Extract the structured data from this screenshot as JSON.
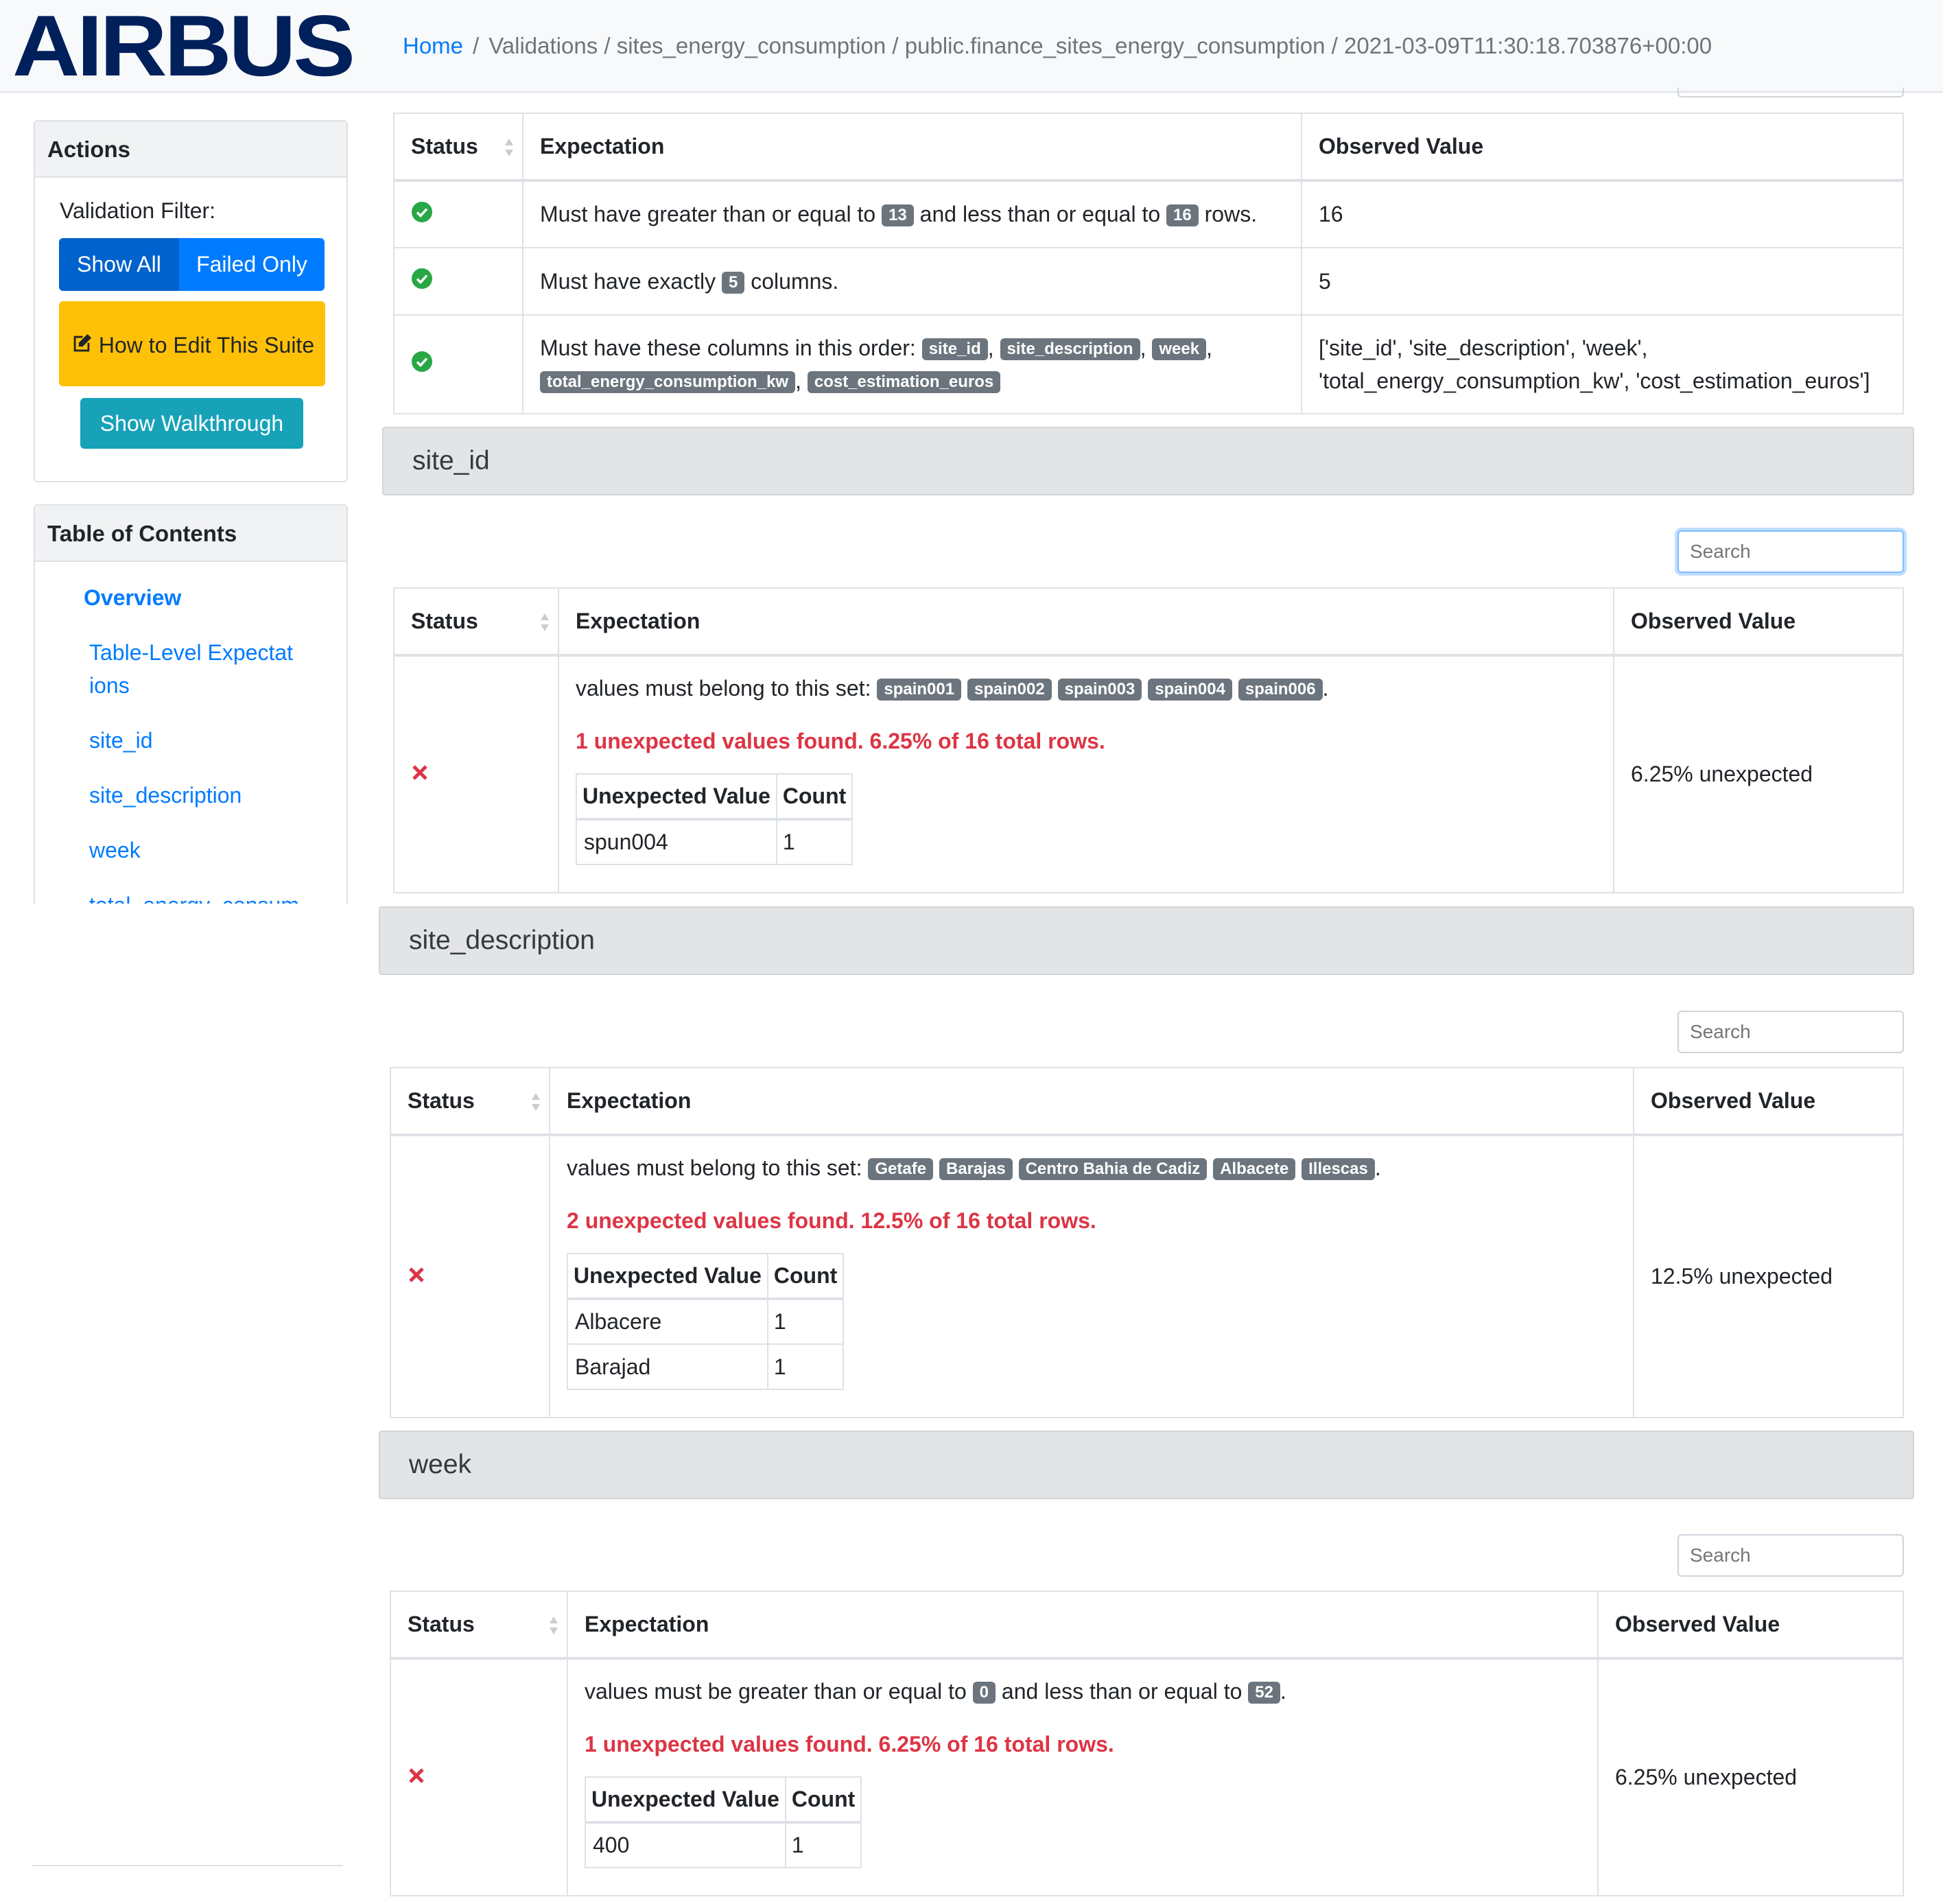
{
  "header": {
    "brand": "AIRBUS",
    "breadcrumb": {
      "home": "Home",
      "separator": "/",
      "path": "Validations / sites_energy_consumption / public.finance_sites_energy_consumption / 2021-03-09T11:30:18.703876+00:00"
    }
  },
  "actions": {
    "title": "Actions",
    "filter_label": "Validation Filter:",
    "show_all": "Show All",
    "failed_only": "Failed Only",
    "edit_suite": "How to Edit This Suite",
    "walkthrough": "Show Walkthrough"
  },
  "toc": {
    "title": "Table of Contents",
    "items": [
      "Overview",
      "Table-Level Expectat ions",
      "site_id",
      "site_description",
      "week",
      "total_energy_consum"
    ]
  },
  "columns": {
    "status": "Status",
    "expectation": "Expectation",
    "observed": "Observed Value"
  },
  "search_placeholder": "Search",
  "unexpected_headers": {
    "value": "Unexpected Value",
    "count": "Count"
  },
  "table_level": {
    "rows": [
      {
        "status": "success",
        "text_a": "Must have greater than or equal to",
        "badge_a": "13",
        "text_b": "and less than or equal to",
        "badge_b": "16",
        "text_c": "rows.",
        "observed": "16"
      },
      {
        "status": "success",
        "text_a": "Must have exactly",
        "badge_a": "5",
        "text_b": "columns.",
        "observed": "5"
      },
      {
        "status": "success",
        "text_a": "Must have these columns in this order:",
        "badges": [
          "site_id",
          "site_description",
          "week",
          "total_energy_consumption_kw",
          "cost_estimation_euros"
        ],
        "observed_line1": "['site_id', 'site_description', 'week',",
        "observed_line2": "'total_energy_consumption_kw', 'cost_estimation_euros']"
      }
    ]
  },
  "sections": [
    {
      "title": "site_id",
      "status": "failed",
      "expectation": "values must belong to this set:",
      "badges": [
        "spain001",
        "spain002",
        "spain003",
        "spain004",
        "spain006"
      ],
      "message": "1 unexpected values found. 6.25% of 16 total rows.",
      "unexpected": [
        {
          "value": "spun004",
          "count": "1"
        }
      ],
      "observed": "6.25% unexpected"
    },
    {
      "title": "site_description",
      "status": "failed",
      "expectation": "values must belong to this set:",
      "badges": [
        "Getafe",
        "Barajas",
        "Centro Bahia de Cadiz",
        "Albacete",
        "Illescas"
      ],
      "message": "2 unexpected values found. 12.5% of 16 total rows.",
      "unexpected": [
        {
          "value": "Albacere",
          "count": "1"
        },
        {
          "value": "Barajad",
          "count": "1"
        }
      ],
      "observed": "12.5% unexpected"
    },
    {
      "title": "week",
      "status": "failed",
      "expectation_a": "values must be greater than or equal to",
      "badge_a": "0",
      "expectation_b": "and less than or equal to",
      "badge_b": "52",
      "message": "1 unexpected values found. 6.25% of 16 total rows.",
      "unexpected": [
        {
          "value": "400",
          "count": "1"
        }
      ],
      "observed": "6.25% unexpected"
    }
  ],
  "colors": {
    "primary": "#007bff",
    "warning": "#ffc107",
    "info": "#17a2b8",
    "danger": "#dc3545",
    "success": "#28a745",
    "brand": "#00205b"
  }
}
